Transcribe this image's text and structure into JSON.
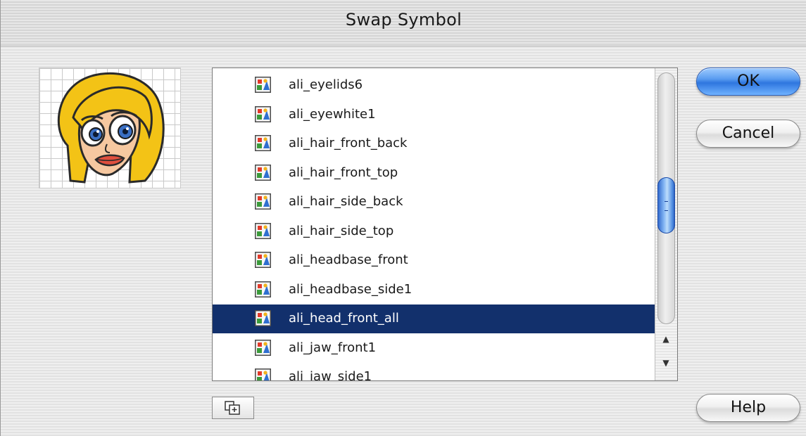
{
  "window": {
    "title": "Swap Symbol"
  },
  "symbols": [
    {
      "label": "ali_eyelids6",
      "selected": false
    },
    {
      "label": "ali_eyewhite1",
      "selected": false
    },
    {
      "label": "ali_hair_front_back",
      "selected": false
    },
    {
      "label": "ali_hair_front_top",
      "selected": false
    },
    {
      "label": "ali_hair_side_back",
      "selected": false
    },
    {
      "label": "ali_hair_side_top",
      "selected": false
    },
    {
      "label": "ali_headbase_front",
      "selected": false
    },
    {
      "label": "ali_headbase_side1",
      "selected": false
    },
    {
      "label": "ali_head_front_all",
      "selected": true
    },
    {
      "label": "ali_jaw_front1",
      "selected": false
    },
    {
      "label": "ali_jaw_side1",
      "selected": false
    }
  ],
  "buttons": {
    "ok": "OK",
    "cancel": "Cancel",
    "help": "Help"
  },
  "icons": {
    "symbol": "graphic-symbol-icon",
    "duplicate": "duplicate-symbol-icon",
    "scroll_up": "scroll-up-arrow-icon",
    "scroll_down": "scroll-down-arrow-icon"
  },
  "colors": {
    "selection": "#12306c",
    "accent": "#2e76df"
  }
}
